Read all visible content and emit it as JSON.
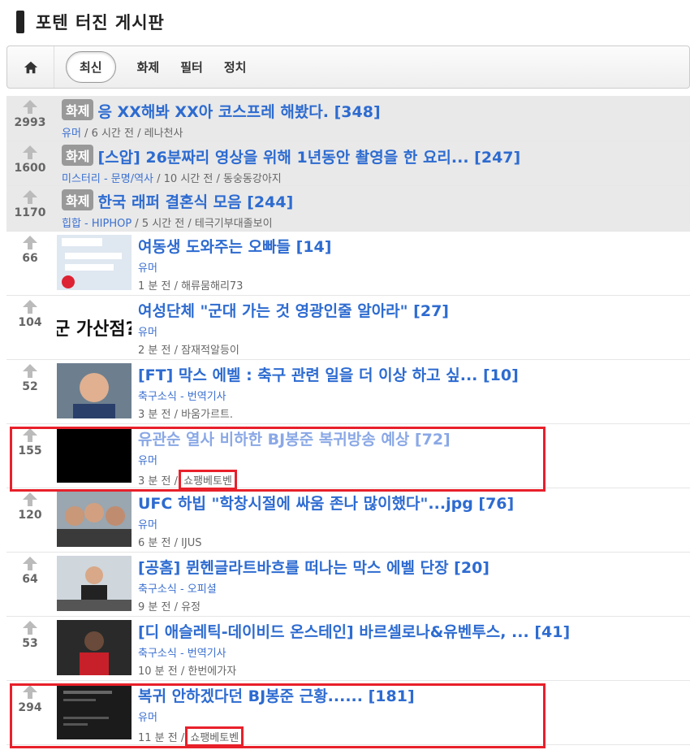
{
  "board": {
    "title": "포텐 터진 게시판"
  },
  "tabs": [
    "최신",
    "화제",
    "필터",
    "정치"
  ],
  "colors": {
    "link": "#2d6bd0",
    "visited": "#8aa8e6",
    "category": "#3b70d0",
    "highlight": "#e8202a"
  },
  "hot_posts": [
    {
      "votes": "2993",
      "badge": "화제",
      "title": "응 XX해봐 XX아 코스프레 해봤다. [348]",
      "meta": "유머 / 6 시간 전 / 레나천사"
    },
    {
      "votes": "1600",
      "badge": "화제",
      "title": "[스압] 26분짜리 영상을 위해 1년동안 촬영을 한 요리... [247]",
      "meta": "미스터리 - 문명/역사 / 10 시간 전 / 동숭동강아지"
    },
    {
      "votes": "1170",
      "badge": "화제",
      "title": "한국 래퍼 결혼식 모음 [244]",
      "meta": "힙합 - HIPHOP / 5 시간 전 / 테극기부대졸보이"
    }
  ],
  "posts": [
    {
      "votes": "66",
      "title": "여동생 도와주는 오빠들 [14]",
      "category": "유머",
      "meta": "1 분 전 / 해류뭄해리73",
      "thumb": "chat-screenshot"
    },
    {
      "votes": "104",
      "title": "여성단체 \"군대 가는 것 영광인줄 알아라\" [27]",
      "category": "유머",
      "meta": "2 분 전 / 잠재적알등이",
      "thumb": "text-thumb",
      "thumb_text": "군 가산점?"
    },
    {
      "votes": "52",
      "title": "[FT] 막스 에벨 : 축구 관련 일을 더 이상 하고 싶... [10]",
      "category": "축구소식 - 번역기사",
      "meta": "3 분 전 / 바움가르트.",
      "thumb": "portrait"
    },
    {
      "votes": "155",
      "title": "유관순 열사 비하한 BJ봉준 복귀방송 예상 [72]",
      "category": "유머",
      "time": "3 분 전 /",
      "author": "쇼팽베토벤",
      "thumb": "black",
      "visited": true
    },
    {
      "votes": "120",
      "title": "UFC 하빕 \"학창시절에 싸움 존나 많이했다\"...jpg [76]",
      "category": "유머",
      "meta": "6 분 전 / IJUS",
      "thumb": "group-photo"
    },
    {
      "votes": "64",
      "title": "[공홈] 뮌헨글라트바흐를 떠나는 막스 에벨 단장 [20]",
      "category": "축구소식 - 오피셜",
      "meta": "9 분 전 / 유정",
      "thumb": "press-conf"
    },
    {
      "votes": "53",
      "title": "[디 애슬레틱-데이비드 온스테인] 바르셀로나&유벤투스, ... [41]",
      "category": "축구소식 - 번역기사",
      "meta": "10 분 전 / 한번에가자",
      "thumb": "player"
    },
    {
      "votes": "294",
      "title": "복귀 안하겠다던 BJ봉준 근황...... [181]",
      "category": "유머",
      "time": "11 분 전 /",
      "author": "쇼팽베토벤",
      "thumb": "dark-chat"
    }
  ]
}
